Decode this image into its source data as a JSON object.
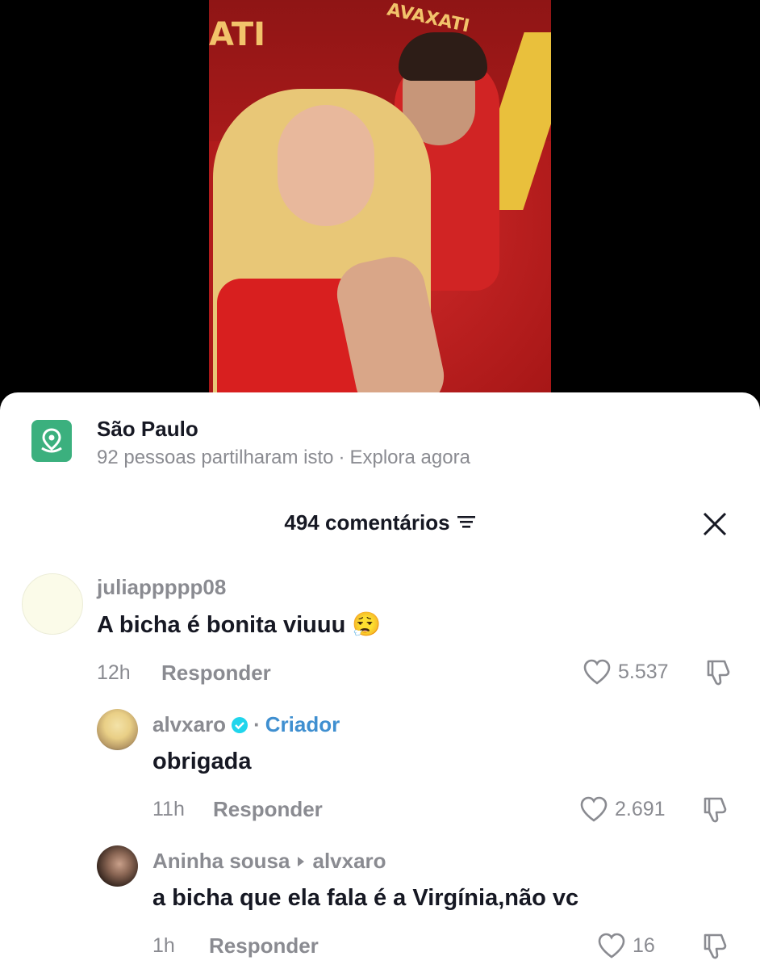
{
  "location": {
    "title": "São Paulo",
    "shared": "92 pessoas partilharam isto",
    "separator": "·",
    "explore": "Explora agora"
  },
  "comments_header": {
    "count_label": "494 comentários"
  },
  "video": {
    "sign_left": "ATI",
    "sign_right": "AVAXATI"
  },
  "comments": [
    {
      "username": "juliappppp08",
      "text": "A bicha é bonita viuuu",
      "emoji": "😮‍💨",
      "time": "12h",
      "reply_label": "Responder",
      "likes": "5.537"
    },
    {
      "username": "alvxaro",
      "badge_sep": "·",
      "badge": "Criador",
      "text": "obrigada",
      "time": "11h",
      "reply_label": "Responder",
      "likes": "2.691"
    },
    {
      "username": "Aninha sousa",
      "reply_to": "alvxaro",
      "text": "a bicha que ela fala é a Virgínia,não vc",
      "time": "1h",
      "reply_label": "Responder",
      "likes": "16"
    }
  ],
  "colors": {
    "accent_blue": "#3f8fd0",
    "location_green": "#3bb07e",
    "muted": "#8a8b91"
  }
}
